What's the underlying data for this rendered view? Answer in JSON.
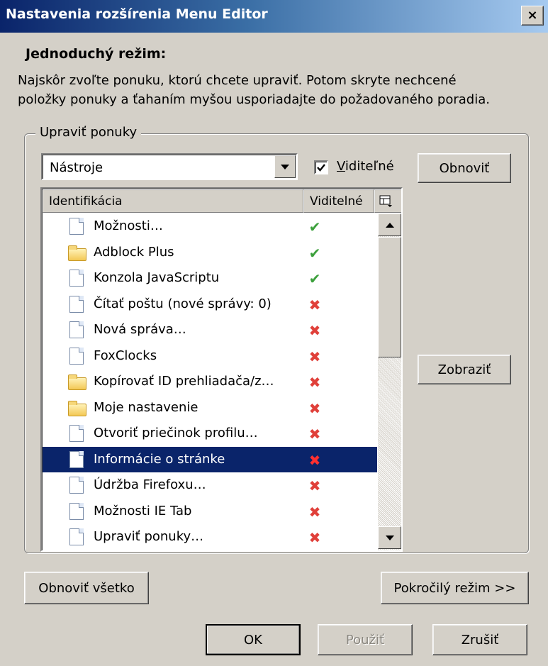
{
  "window": {
    "title": "Nastavenia rozšírenia Menu Editor",
    "close_label": "×"
  },
  "intro": {
    "heading": "Jednoduchý režim:",
    "line1": "Najskôr zvoľte ponuku, ktorú chcete upraviť. Potom skryte nechcené",
    "line2": "položky ponuky a ťahaním myšou usporiadajte do požadovaného poradia."
  },
  "group": {
    "legend": "Upraviť ponuky",
    "menu_select_value": "Nástroje",
    "visible_checkbox_label": "Viditeľné",
    "visible_checkbox_checked": true,
    "refresh_button": "Obnoviť",
    "show_button": "Zobraziť"
  },
  "list": {
    "col_id": "Identifikácia",
    "col_visible": "Viditelné",
    "rows": [
      {
        "label": "Možnosti…",
        "icon": "document-icon",
        "visible": "✔"
      },
      {
        "label": "Adblock Plus",
        "icon": "folder-icon",
        "visible": "✔"
      },
      {
        "label": "Konzola JavaScriptu",
        "icon": "document-icon",
        "visible": "✔"
      },
      {
        "label": "Čítať poštu (nové správy: 0)",
        "icon": "document-icon",
        "visible": "✖"
      },
      {
        "label": "Nová správa…",
        "icon": "document-icon",
        "visible": "✖"
      },
      {
        "label": "FoxClocks",
        "icon": "document-icon",
        "visible": "✖"
      },
      {
        "label": "Kopírovať ID prehliadača/z…",
        "icon": "folder-icon",
        "visible": "✖"
      },
      {
        "label": "Moje nastavenie",
        "icon": "folder-icon",
        "visible": "✖"
      },
      {
        "label": "Otvoriť priečinok profilu…",
        "icon": "document-icon",
        "visible": "✖"
      },
      {
        "label": "Informácie o stránke",
        "icon": "document-icon",
        "visible": "✖"
      },
      {
        "label": "Údržba Firefoxu…",
        "icon": "document-icon",
        "visible": "✖"
      },
      {
        "label": "Možnosti IE Tab",
        "icon": "document-icon",
        "visible": "✖"
      },
      {
        "label": "Upraviť ponuky…",
        "icon": "document-icon",
        "visible": "✖"
      }
    ],
    "selected_row": "Informácie o stránke"
  },
  "buttons": {
    "reset_all": "Obnoviť všetko",
    "advanced": "Pokročilý režim >>",
    "ok": "OK",
    "apply": "Použiť",
    "cancel": "Zrušiť"
  },
  "colors": {
    "titlebar": "#0a246a",
    "selection": "#0a246a",
    "check_green": "#3ca03c",
    "cross_red": "#e0403a",
    "face": "#d4d0c8"
  }
}
